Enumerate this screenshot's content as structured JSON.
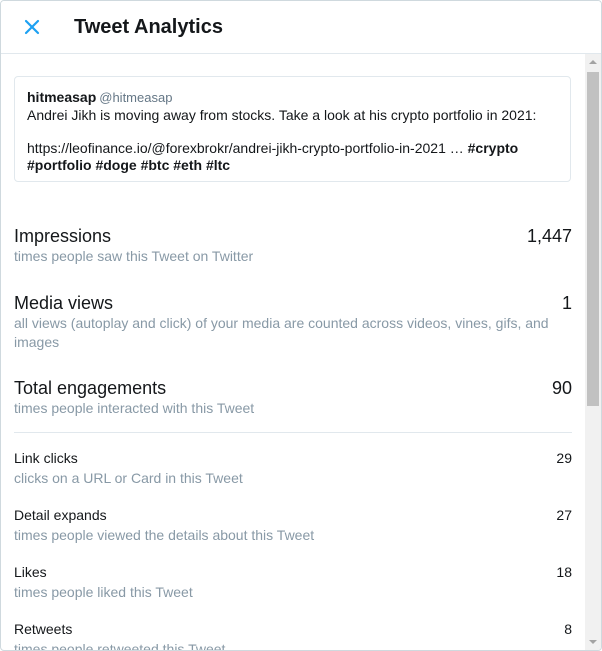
{
  "header": {
    "title": "Tweet Analytics"
  },
  "tweet": {
    "name": "hitmeasap",
    "handle": "@hitmeasap",
    "text": "Andrei Jikh is moving away from stocks. Take a look at his crypto portfolio in 2021:",
    "url": "https://leofinance.io/@forexbrokr/andrei-jikh-crypto-portfolio-in-2021 …",
    "hashtags": [
      "#crypto",
      "#portfolio",
      "#doge",
      "#btc",
      "#eth",
      "#ltc"
    ]
  },
  "metrics": {
    "impressions": {
      "label": "Impressions",
      "value": "1,447",
      "desc": "times people saw this Tweet on Twitter"
    },
    "media_views": {
      "label": "Media views",
      "value": "1",
      "desc": "all views (autoplay and click) of your media are counted across videos, vines, gifs, and images"
    },
    "engagements": {
      "label": "Total engagements",
      "value": "90",
      "desc": "times people interacted with this Tweet"
    },
    "link_clicks": {
      "label": "Link clicks",
      "value": "29",
      "desc": "clicks on a URL or Card in this Tweet"
    },
    "detail_expands": {
      "label": "Detail expands",
      "value": "27",
      "desc": "times people viewed the details about this Tweet"
    },
    "likes": {
      "label": "Likes",
      "value": "18",
      "desc": "times people liked this Tweet"
    },
    "retweets": {
      "label": "Retweets",
      "value": "8",
      "desc": "times people retweeted this Tweet"
    }
  },
  "colors": {
    "accent": "#1da1f2",
    "muted": "#8899a6",
    "text": "#14171a"
  },
  "icons": {
    "close": "close-icon"
  }
}
